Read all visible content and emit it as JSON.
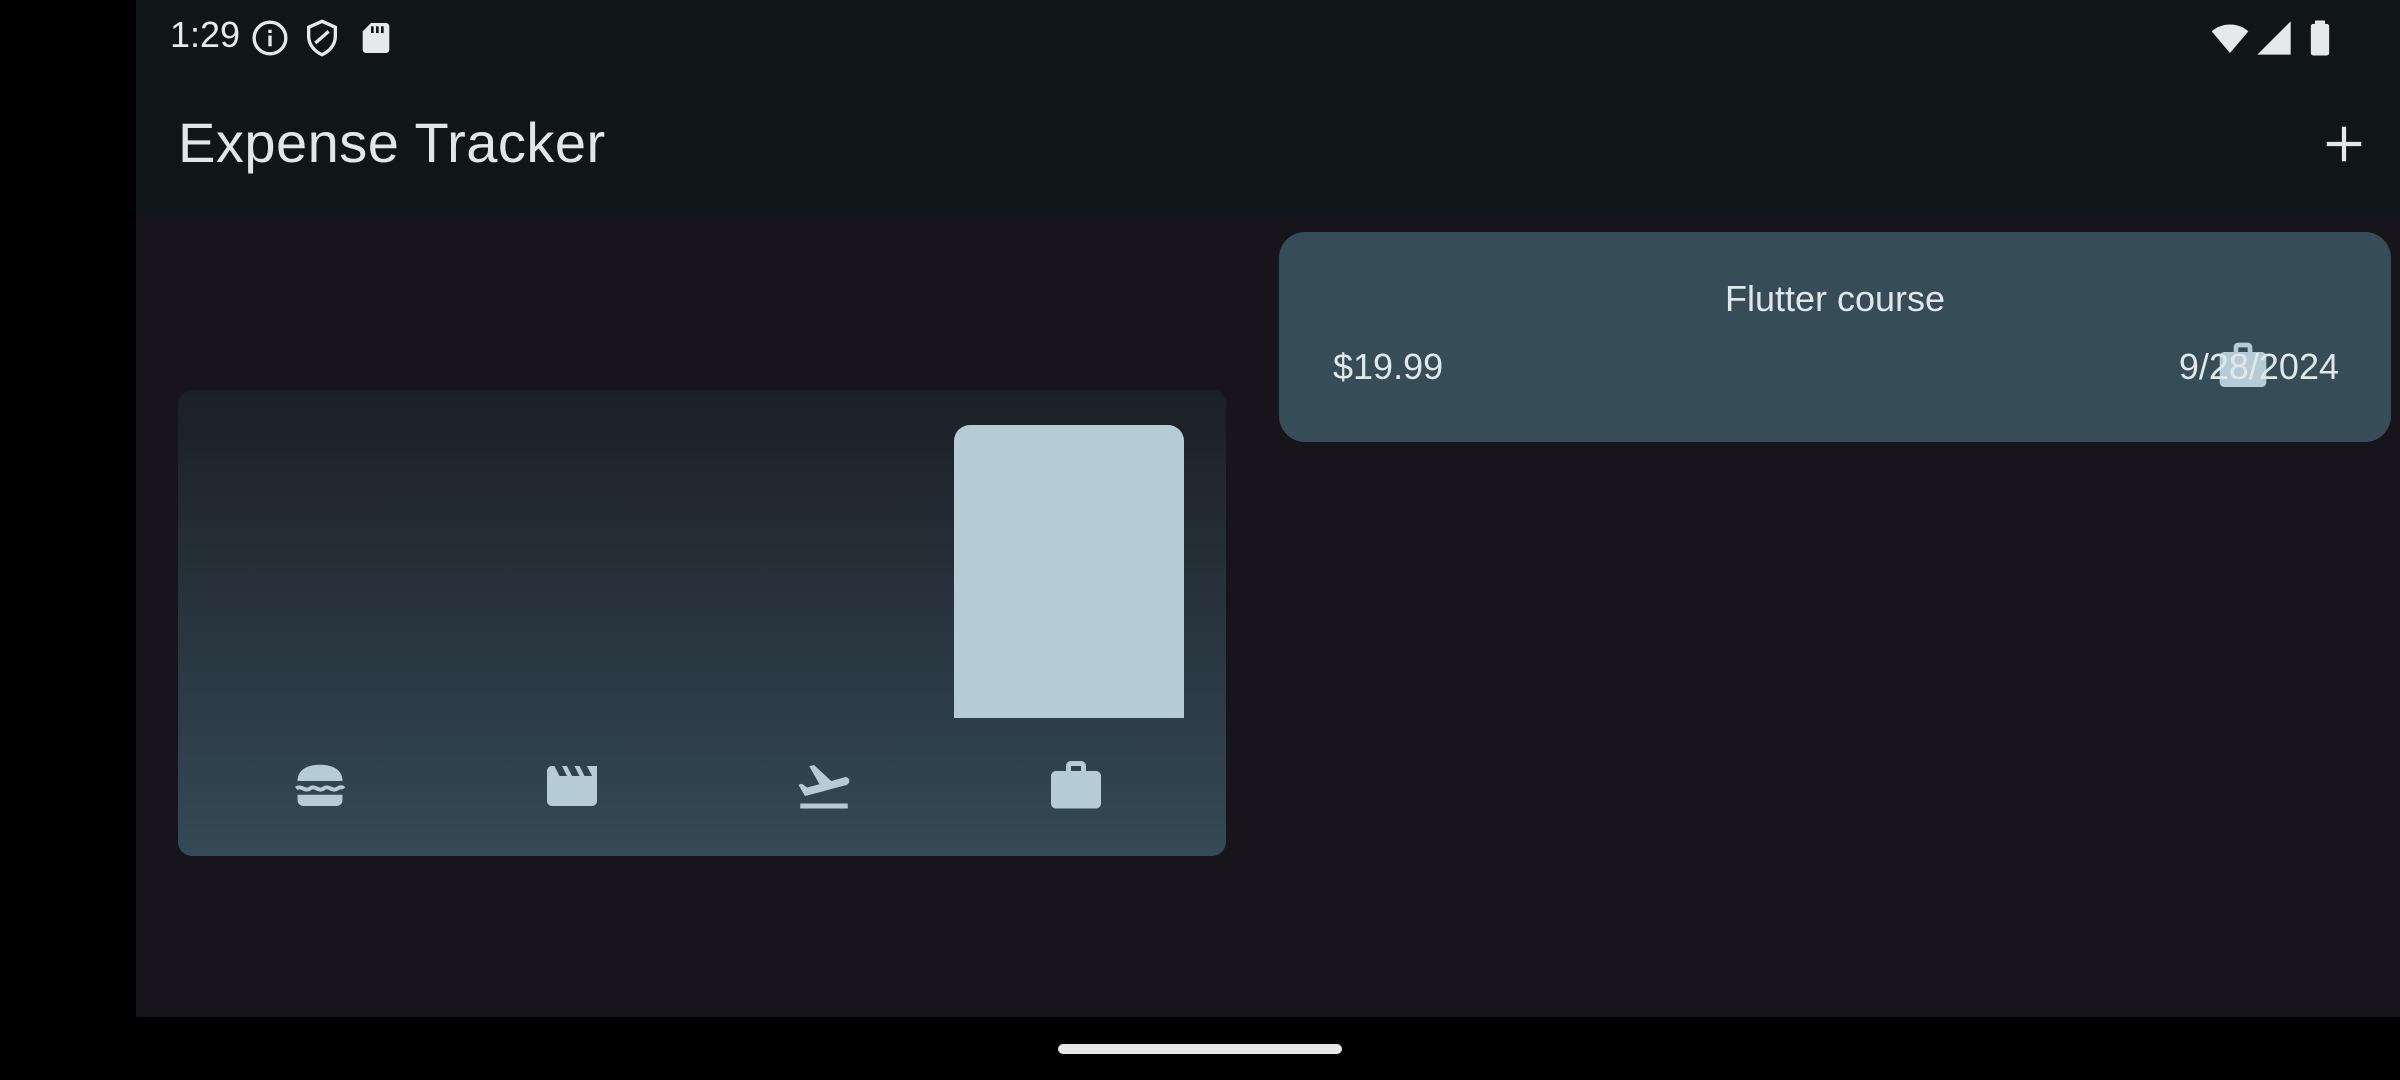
{
  "status_bar": {
    "time": "1:29",
    "left_icons": [
      "info-icon",
      "shield-icon",
      "sd-card-icon"
    ],
    "right_icons": [
      "wifi-icon",
      "signal-icon",
      "battery-icon"
    ]
  },
  "app_bar": {
    "title": "Expense Tracker",
    "action_icon": "add-icon"
  },
  "chart": {
    "bar_color": "#b5cbd5",
    "buckets": [
      {
        "category": "food",
        "icon": "food-icon",
        "fill": 0
      },
      {
        "category": "leisure",
        "icon": "movie-icon",
        "fill": 0
      },
      {
        "category": "travel",
        "icon": "flight-takeoff-icon",
        "fill": 0
      },
      {
        "category": "work",
        "icon": "work-icon",
        "fill": 1
      }
    ]
  },
  "expenses": [
    {
      "title": "Flutter course",
      "amount": "$19.99",
      "category_icon": "work-icon",
      "date": "9/28/2024"
    }
  ],
  "colors": {
    "app_background": "#17151b",
    "bar_background": "#101518",
    "card": "#364c56",
    "accent": "#b5cbd5"
  }
}
